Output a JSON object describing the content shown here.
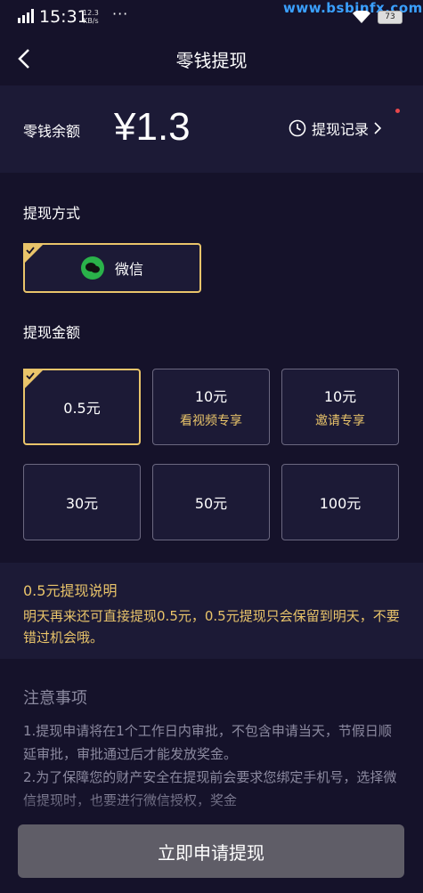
{
  "status_bar": {
    "time": "15:31",
    "network_speed": "12.3",
    "network_unit": "KB/s",
    "more": "···",
    "battery": "73",
    "watermark": "www.bsbinfx.com"
  },
  "header": {
    "title": "零钱提现"
  },
  "balance": {
    "label": "零钱余额",
    "amount": "¥1.3",
    "history_label": "提现记录"
  },
  "method": {
    "section_label": "提现方式",
    "option_label": "微信"
  },
  "amount": {
    "section_label": "提现金额",
    "options": [
      {
        "value": "0.5元",
        "sub": ""
      },
      {
        "value": "10元",
        "sub": "看视频专享"
      },
      {
        "value": "10元",
        "sub": "邀请专享"
      },
      {
        "value": "30元",
        "sub": ""
      },
      {
        "value": "50元",
        "sub": ""
      },
      {
        "value": "100元",
        "sub": ""
      }
    ]
  },
  "note": {
    "title": "0.5元提现说明",
    "body": "明天再来还可直接提现0.5元，0.5元提现只会保留到明天，不要错过机会哦。"
  },
  "notice": {
    "title": "注意事项",
    "line1": "1.提现申请将在1个工作日内审批，不包含申请当天，节假日顺延审批，审批通过后才能发放奖金。",
    "line2": "2.为了保障您的财产安全在提现前会要求您绑定手机号，选择微信提现时，也要进行微信授权，奖金"
  },
  "cta": {
    "label": "立即申请提现"
  },
  "colors": {
    "accent": "#e9c46a",
    "background": "#15122a",
    "card": "#1c1a36",
    "wechat": "#2ab24a",
    "dot": "#e8474b"
  }
}
